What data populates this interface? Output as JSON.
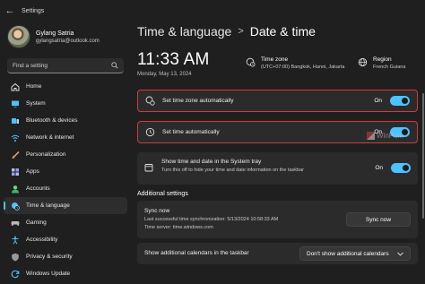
{
  "app": {
    "title": "Settings"
  },
  "profile": {
    "name": "Gylang Satria",
    "email": "gylangsatria@outlook.com"
  },
  "search": {
    "placeholder": "Find a setting"
  },
  "sidebar": {
    "items": [
      {
        "label": "Home",
        "icon": "home-icon",
        "active": false
      },
      {
        "label": "System",
        "icon": "system-icon",
        "active": false
      },
      {
        "label": "Bluetooth & devices",
        "icon": "bluetooth-icon",
        "active": false
      },
      {
        "label": "Network & internet",
        "icon": "network-icon",
        "active": false
      },
      {
        "label": "Personalization",
        "icon": "brush-icon",
        "active": false
      },
      {
        "label": "Apps",
        "icon": "apps-icon",
        "active": false
      },
      {
        "label": "Accounts",
        "icon": "accounts-icon",
        "active": false
      },
      {
        "label": "Time & language",
        "icon": "globe-clock-icon",
        "active": true
      },
      {
        "label": "Gaming",
        "icon": "gamepad-icon",
        "active": false
      },
      {
        "label": "Accessibility",
        "icon": "accessibility-icon",
        "active": false
      },
      {
        "label": "Privacy & security",
        "icon": "shield-icon",
        "active": false
      },
      {
        "label": "Windows Update",
        "icon": "update-icon",
        "active": false
      }
    ]
  },
  "breadcrumb": {
    "parent": "Time & language",
    "separator": ">",
    "current": "Date & time"
  },
  "clock": {
    "time": "11:33 AM",
    "date": "Monday, May 13, 2024"
  },
  "timezone_info": {
    "label": "Time zone",
    "value": "(UTC+07:00) Bangkok, Hanoi, Jakarta"
  },
  "region_info": {
    "label": "Region",
    "value": "French Guiana"
  },
  "settings": {
    "auto_timezone": {
      "label": "Set time zone automatically",
      "state": "On",
      "on": true
    },
    "auto_time": {
      "label": "Set time automatically",
      "state": "On",
      "on": true
    },
    "tray": {
      "label": "Show time and date in the System tray",
      "sublabel": "Turn this off to hide your time and date information on the taskbar",
      "state": "On",
      "on": true
    }
  },
  "additional": {
    "title": "Additional settings",
    "sync": {
      "title": "Sync now",
      "last_sync": "Last successful time synchronization: 5/13/2024 10:58:33 AM",
      "server": "Time server: time.windows.com",
      "button": "Sync now"
    },
    "calendars": {
      "label": "Show additional calendars in the taskbar",
      "selected": "Don't show additional calendars"
    }
  },
  "watermark": {
    "text": "WinPoin"
  },
  "colors": {
    "accent": "#4cc2ff",
    "highlight": "#d23a3a",
    "background": "#1f1f1f",
    "card": "#2b2b2b"
  }
}
